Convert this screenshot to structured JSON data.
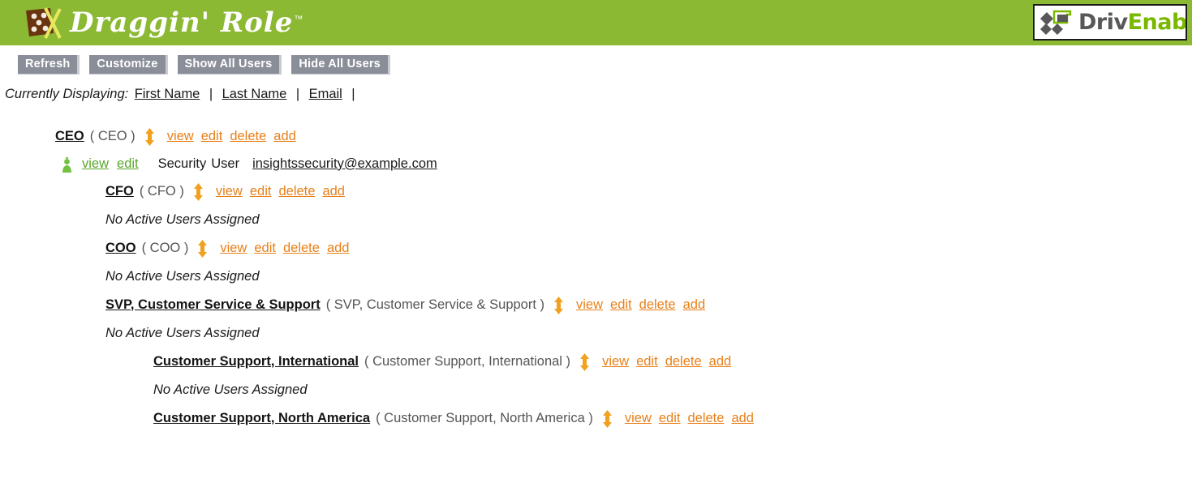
{
  "header": {
    "brand_name": "Draggin' Role",
    "brand_tm": "™",
    "brand_mark_icon": "domino-x-icon",
    "partner": {
      "text_part1": "Driv",
      "text_part2": "Enable",
      "reg": "®",
      "mark_icon": "diamonds-icon",
      "color_part1": "#58585a",
      "color_part2": "#7ab800"
    },
    "bar_color": "#8cb933"
  },
  "toolbar": {
    "buttons": [
      {
        "label": "Refresh",
        "name": "refresh-button"
      },
      {
        "label": "Customize",
        "name": "customize-button"
      },
      {
        "label": "Show All Users",
        "name": "show-all-users-button"
      },
      {
        "label": "Hide All Users",
        "name": "hide-all-users-button"
      }
    ],
    "button_bg": "#8a8e99"
  },
  "displaying": {
    "label": "Currently Displaying:",
    "fields": [
      "First Name",
      "Last Name",
      "Email"
    ],
    "separator": "|",
    "trailing_separator": "|"
  },
  "tree": {
    "action_labels": {
      "view": "view",
      "edit": "edit",
      "delete": "delete",
      "add": "add"
    },
    "action_color": "#e8801a",
    "user_action_color": "#5aa72b",
    "drag_handle_icon": "vertical-double-arrow-icon",
    "user_icon": "person-icon",
    "empty_text": "No Active Users Assigned",
    "nodes": [
      {
        "level": 1,
        "title": "CEO",
        "paren": "( CEO )",
        "user": {
          "first_name": "Security",
          "last_name": "User",
          "email": "insightssecurity@example.com",
          "view": "view",
          "edit": "edit"
        }
      },
      {
        "level": 2,
        "title": "CFO",
        "paren": "( CFO )",
        "empty": "No Active Users Assigned"
      },
      {
        "level": 2,
        "title": "COO",
        "paren": "( COO )",
        "empty": "No Active Users Assigned"
      },
      {
        "level": 2,
        "title": "SVP, Customer Service & Support",
        "paren": "( SVP, Customer Service & Support )",
        "empty": "No Active Users Assigned"
      },
      {
        "level": 3,
        "title": "Customer Support, International",
        "paren": "( Customer Support, International )",
        "empty": "No Active Users Assigned"
      },
      {
        "level": 3,
        "title": "Customer Support, North America",
        "paren": "( Customer Support, North America )"
      }
    ]
  }
}
